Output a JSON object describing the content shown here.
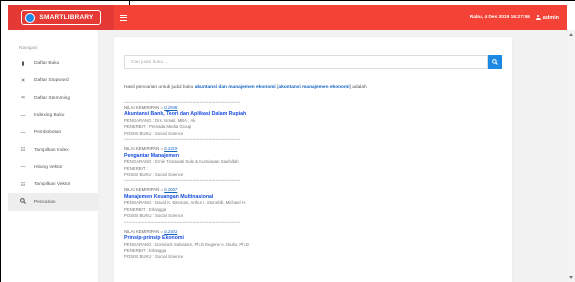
{
  "header": {
    "brand": "SMARTLIBRARY",
    "datetime": "Rabu, 4 Des 2019 16:27:58",
    "user": "admin"
  },
  "sidebar": {
    "heading": "Navigasi",
    "items": [
      {
        "icon": "book-icon",
        "glyph": "▮",
        "label": "Daftar Buku"
      },
      {
        "icon": "close-icon",
        "glyph": "✕",
        "label": "Daftar Stopword"
      },
      {
        "icon": "approx-icon",
        "glyph": "≈",
        "label": "Daftar Stemming"
      },
      {
        "icon": "dash-icon",
        "glyph": "—",
        "label": "Indexing Buku"
      },
      {
        "icon": "dash-icon",
        "glyph": "—",
        "label": "Pembobotan"
      },
      {
        "icon": "list-icon",
        "glyph": "☷",
        "label": "Tampilkan Index"
      },
      {
        "icon": "dash-icon",
        "glyph": "—",
        "label": "Hitung Vektor"
      },
      {
        "icon": "list-icon",
        "glyph": "☷",
        "label": "Tampilkan Vektor"
      },
      {
        "icon": "search-icon",
        "glyph": "🔍",
        "label": "Pencarian"
      }
    ]
  },
  "search": {
    "placeholder": "Cari judul buku ....",
    "intro_prefix": "Hasil pencarian untuk judul buku",
    "query": "akuntansi dan manajemen ekonomi",
    "bracket_query": "akuntansi manajemen ekonomi",
    "intro_suffix": "adalah"
  },
  "results": [
    {
      "score_label": "NILAI KEMIRIPAN =",
      "score": "0.2948",
      "title": "Akuntansi Bank, Teori dan Aplikasi Dalam Rupiah",
      "author": "PENGARANG : Drs. Ismail, MBA., Ak",
      "publisher": "PENERBIT : Prenada Media Group",
      "position": "POSISI BUKU : Social Science"
    },
    {
      "score_label": "NILAI KEMIRIPAN =",
      "score": "0.2319",
      "title": "Pengantar Manajemen",
      "author": "PENGARANG : Ernie Tisnawati Sule & Kurniawan Saefullah",
      "publisher": "PENERBIT :",
      "position": "POSISI BUKU : Social Science"
    },
    {
      "score_label": "NILAI KEMIRIPAN =",
      "score": "0.2007",
      "title": "Manajemen Keuangan Multinasional",
      "author": "PENGARANG : David K. Eiteman, Arthur I. Stonehill, Michael H.",
      "publisher": "PENERBIT : Erlangga",
      "position": "POSISI BUKU : Social Science"
    },
    {
      "score_label": "NILAI KEMIRIPAN =",
      "score": "0.2401",
      "title": "Prinsip-prinsip Ekonomi",
      "author": "PENGARANG : Dominick Salvatore, Ph.D Eugene A. Diulio, Ph.D",
      "publisher": "PENERBIT : Erlangga",
      "position": "POSISI BUKU : Social Science"
    }
  ],
  "separator": "++++++++++++++++++++++++++++++++++++++++++++++++++++++++++++++++++++++++++++++++",
  "colors": {
    "topbar": "#f44336",
    "brand_bg": "#e53935",
    "accent": "#1e88e5",
    "result_title": "#1a4fe0"
  }
}
